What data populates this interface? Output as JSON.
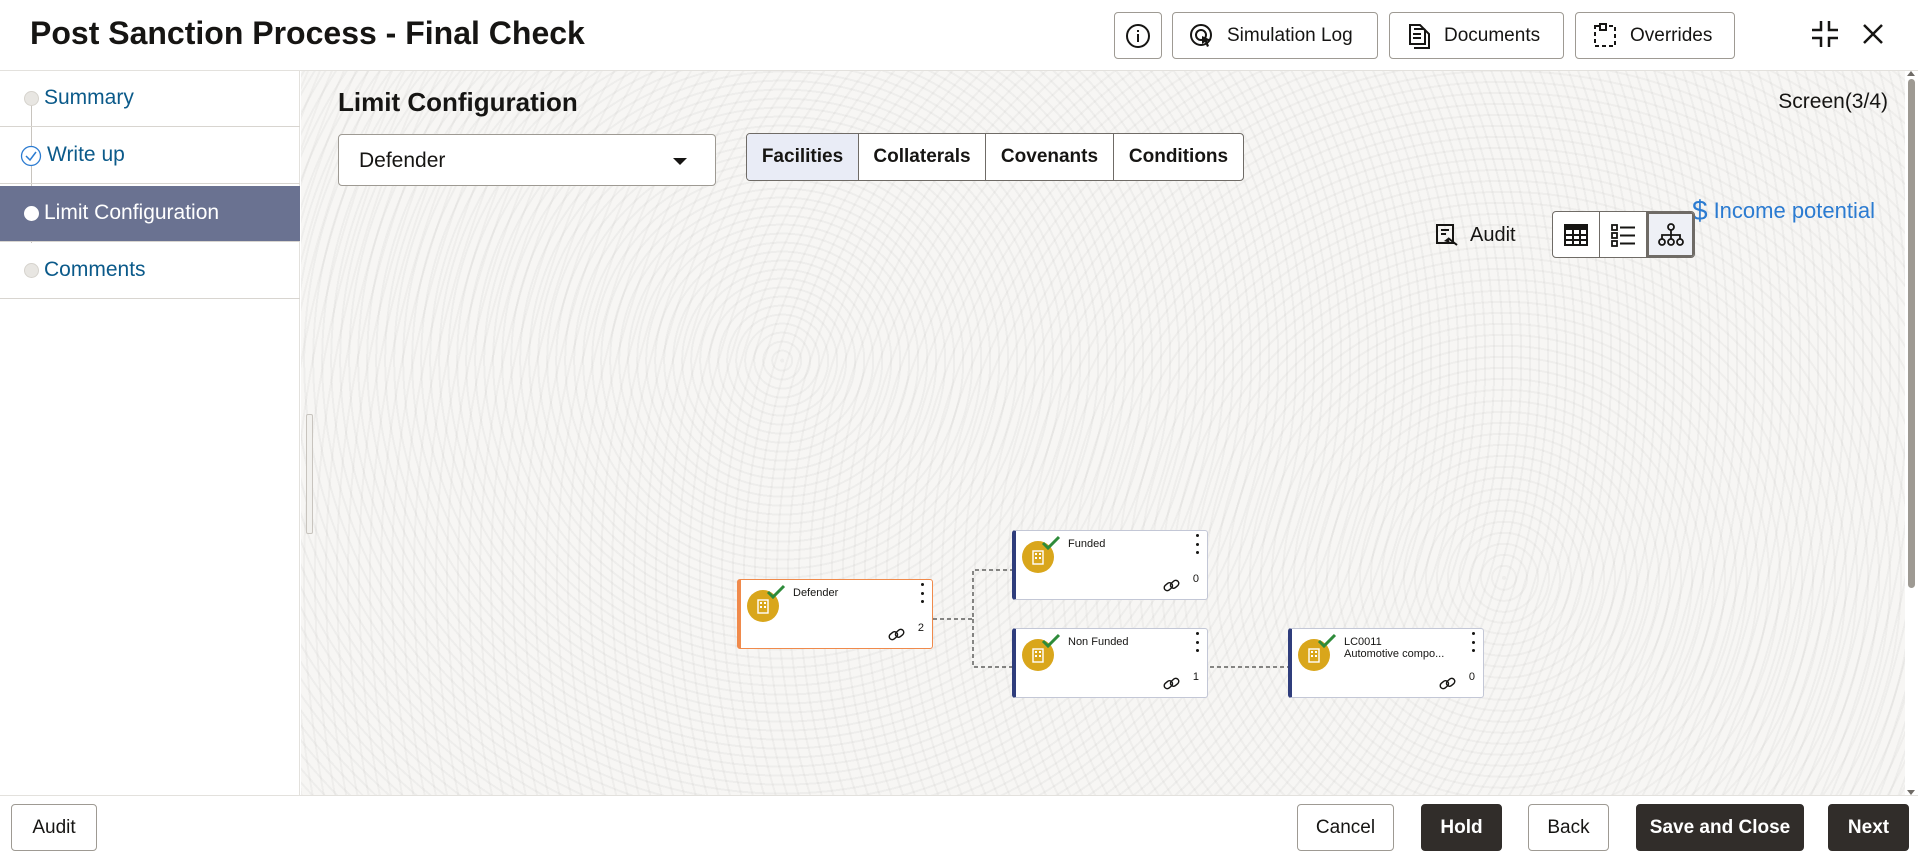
{
  "header": {
    "title": "Post Sanction Process - Final Check",
    "info_icon": "info-icon",
    "simulation_log_label": "Simulation Log",
    "documents_label": "Documents",
    "overrides_label": "Overrides"
  },
  "sidebar": {
    "items": [
      {
        "label": "Summary",
        "state": "pending"
      },
      {
        "label": "Write up",
        "state": "completed"
      },
      {
        "label": "Limit Configuration",
        "state": "active"
      },
      {
        "label": "Comments",
        "state": "pending"
      }
    ]
  },
  "main": {
    "section_title": "Limit Configuration",
    "screen_indicator": "Screen(3/4)",
    "party_select": {
      "value": "Defender"
    },
    "tabs": [
      {
        "label": "Facilities",
        "active": true
      },
      {
        "label": "Collaterals",
        "active": false
      },
      {
        "label": "Covenants",
        "active": false
      },
      {
        "label": "Conditions",
        "active": false
      }
    ],
    "income_potential_symbol": "$",
    "income_potential_label": "Income potential",
    "audit_label": "Audit",
    "view_modes": [
      "table-view-icon",
      "list-view-icon",
      "hierarchy-view-icon"
    ],
    "active_view": "hierarchy-view-icon"
  },
  "tree": {
    "nodes": [
      {
        "id": "root",
        "title": "Defender",
        "subtitle": "",
        "link_count": "2"
      },
      {
        "id": "funded",
        "title": "Funded",
        "subtitle": "",
        "link_count": "0"
      },
      {
        "id": "nonfunded",
        "title": "Non Funded",
        "subtitle": "",
        "link_count": "1"
      },
      {
        "id": "lc0011",
        "title": "LC0011",
        "subtitle": "Automotive compo...",
        "link_count": "0"
      }
    ]
  },
  "footer": {
    "audit_label": "Audit",
    "cancel_label": "Cancel",
    "hold_label": "Hold",
    "back_label": "Back",
    "save_close_label": "Save and Close",
    "next_label": "Next"
  },
  "colors": {
    "active_step_bg": "#6a7291",
    "link_blue": "#2b7bd1",
    "node_accent": "#2f3d7c",
    "root_accent": "#f08a4b",
    "avatar": "#d9a61b",
    "primary_button": "#312d2a"
  }
}
